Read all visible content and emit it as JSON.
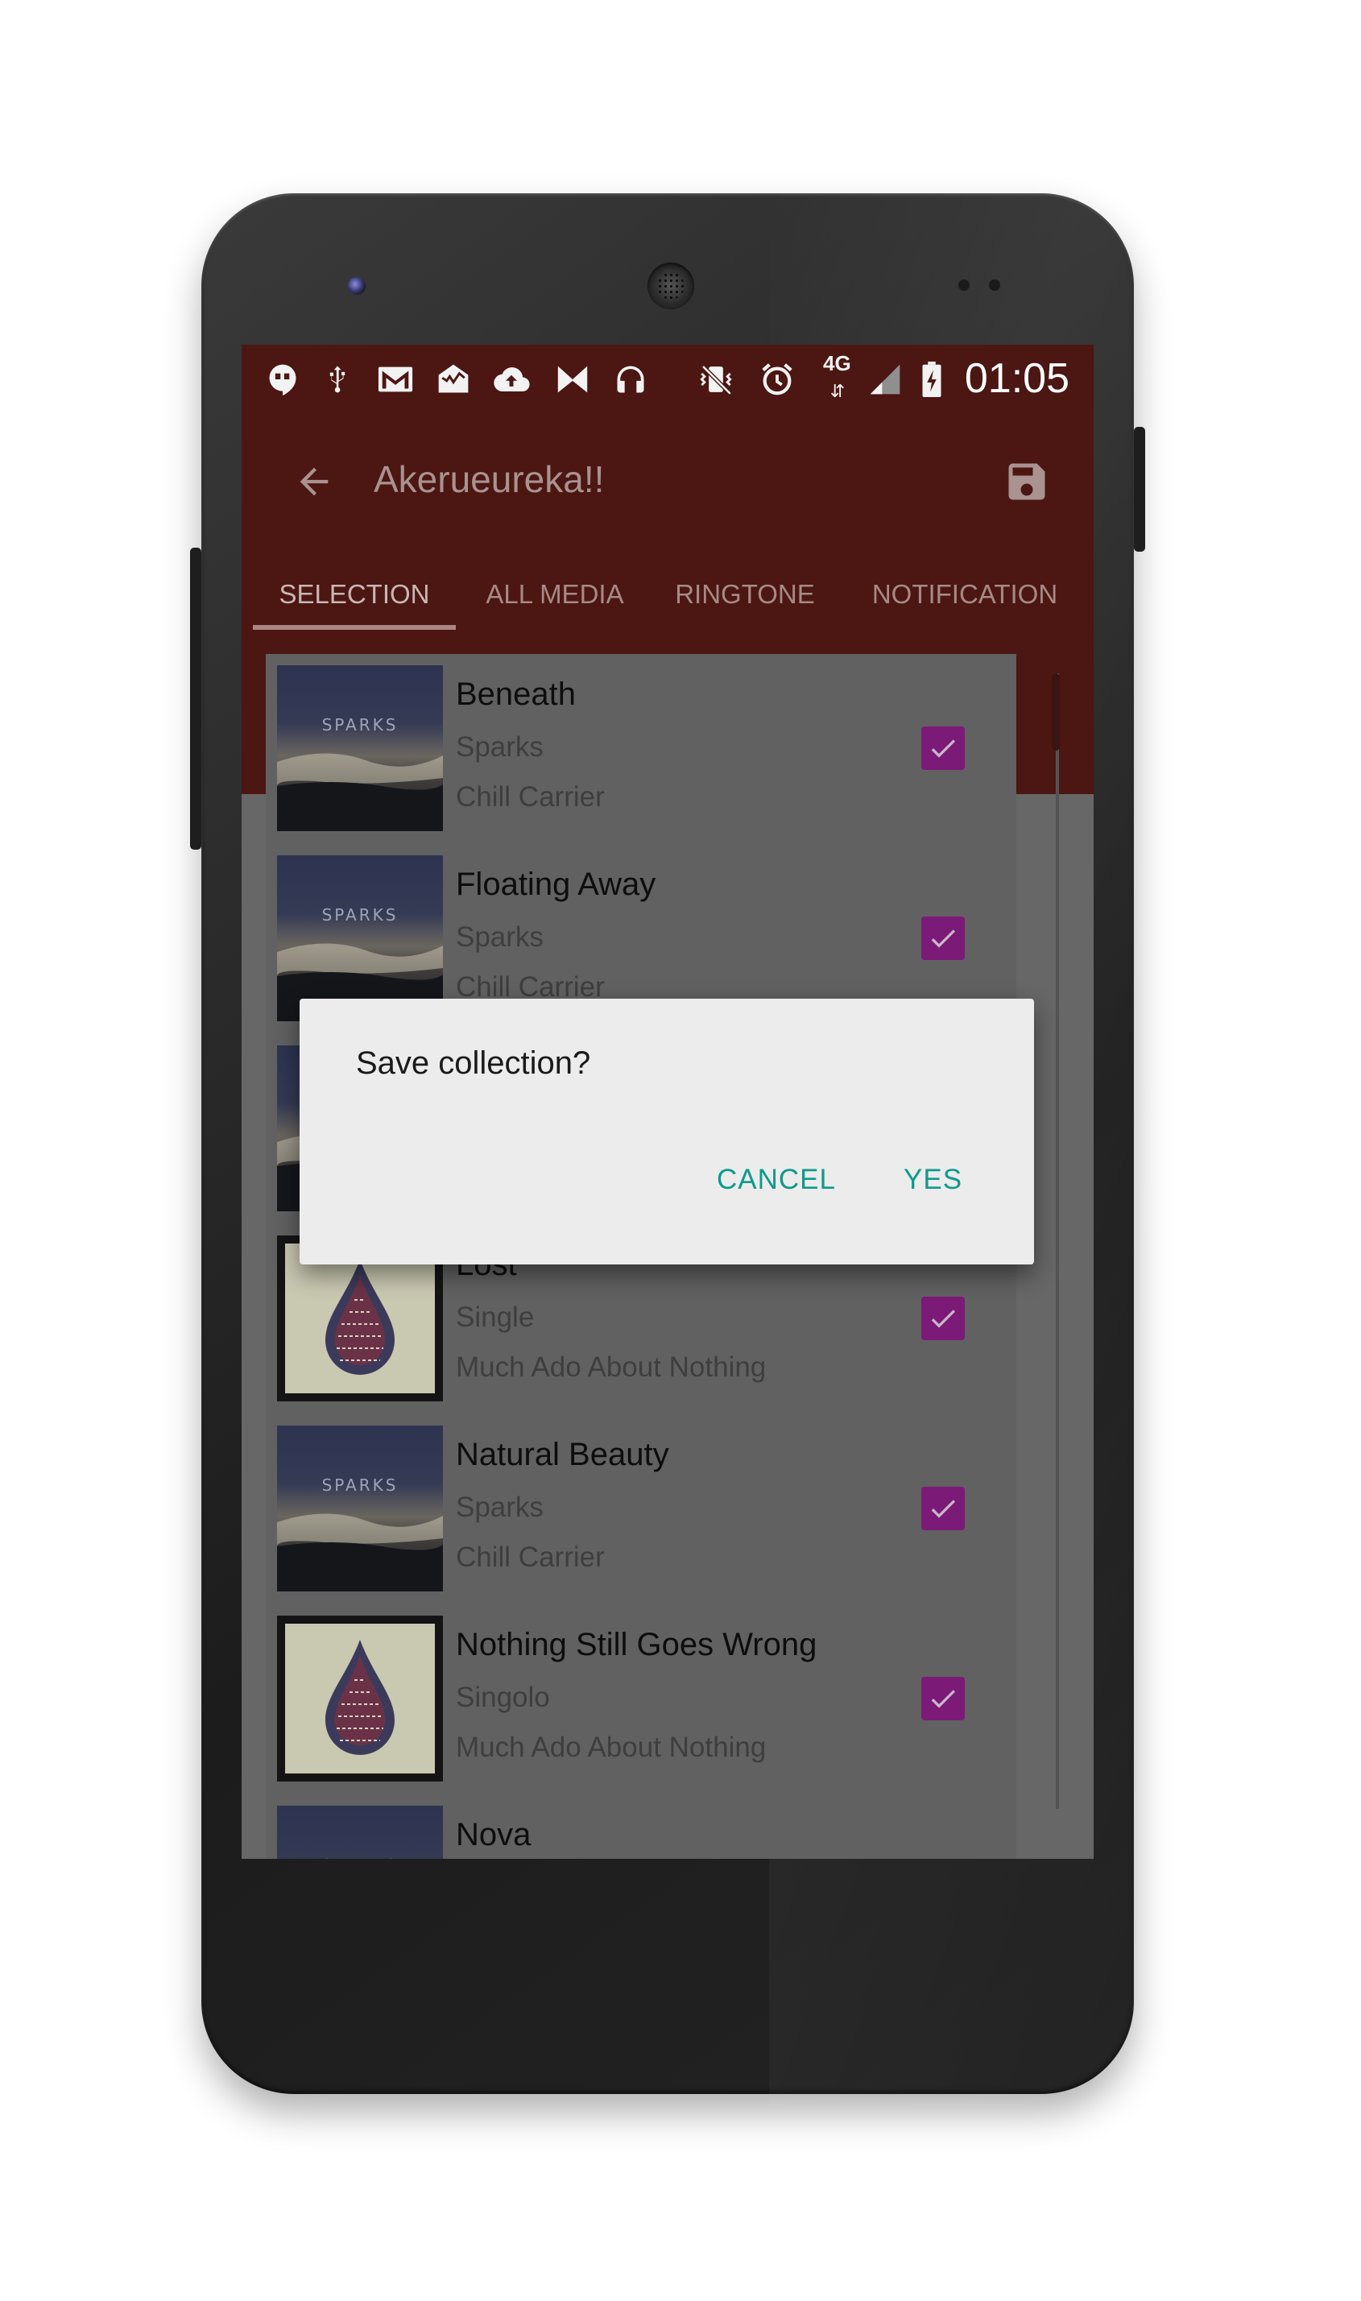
{
  "status_bar": {
    "icons": [
      "hangouts-icon",
      "usb-icon",
      "gmail-icon",
      "inbox-icon",
      "cloud-upload-icon",
      "mail-inbox-icon",
      "headphones-icon",
      "vibrate-icon",
      "alarm-icon",
      "signal-icon",
      "battery-charging-icon"
    ],
    "network_label": "4G",
    "time": "01:05"
  },
  "toolbar": {
    "title": "Akerueureka!!"
  },
  "tabs": [
    {
      "label": "SELECTION",
      "active": true
    },
    {
      "label": "ALL MEDIA",
      "active": false
    },
    {
      "label": "RINGTONE",
      "active": false
    },
    {
      "label": "NOTIFICATION",
      "active": false
    }
  ],
  "list": [
    {
      "title": "Beneath",
      "artist": "Sparks",
      "album": "Chill Carrier",
      "checked": true,
      "art": "sparks"
    },
    {
      "title": "Floating Away",
      "artist": "Sparks",
      "album": "Chill Carrier",
      "checked": true,
      "art": "sparks"
    },
    {
      "title": "",
      "artist": "",
      "album": "",
      "checked": true,
      "art": "sparks"
    },
    {
      "title": "Lost",
      "artist": "Single",
      "album": "Much Ado About Nothing",
      "checked": true,
      "art": "drop"
    },
    {
      "title": "Natural Beauty",
      "artist": "Sparks",
      "album": "Chill Carrier",
      "checked": true,
      "art": "sparks"
    },
    {
      "title": "Nothing Still Goes Wrong",
      "artist": "Singolo",
      "album": "Much Ado About Nothing",
      "checked": true,
      "art": "drop"
    },
    {
      "title": "Nova",
      "artist": "",
      "album": "",
      "checked": false,
      "art": "sparks"
    }
  ],
  "album_art_text": "SPARKS",
  "dialog": {
    "message": "Save collection?",
    "cancel_label": "CANCEL",
    "yes_label": "YES"
  },
  "colors": {
    "appbar": "#4c1612",
    "check_accent": "#7c1a78",
    "dialog_button": "#0f9a8c"
  }
}
